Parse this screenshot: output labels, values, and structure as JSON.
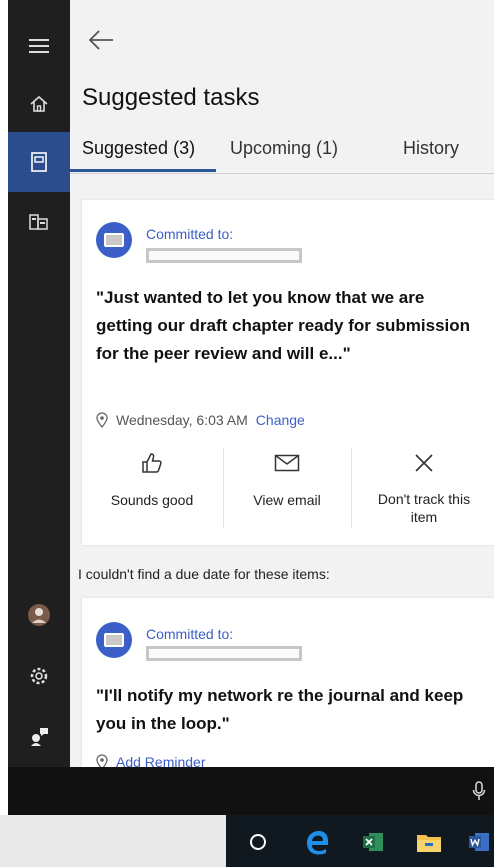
{
  "header": {
    "title": "Suggested tasks"
  },
  "tabs": [
    {
      "label": "Suggested (3)"
    },
    {
      "label": "Upcoming (1)"
    },
    {
      "label": "History"
    }
  ],
  "cards": [
    {
      "committed_label": "Committed to:",
      "quote": "\"Just wanted to let you know that we are getting our draft chapter ready for submission for the peer review and will e...\"",
      "when": "Wednesday, 6:03 AM",
      "change_label": "Change",
      "actions": [
        {
          "label": "Sounds good",
          "icon": "thumbs-up-icon"
        },
        {
          "label": "View email",
          "icon": "mail-icon"
        },
        {
          "label": "Don't track this item",
          "icon": "close-icon"
        }
      ]
    },
    {
      "committed_label": "Committed to:",
      "quote": "\"I'll notify my network re the journal and keep you in the loop.\"",
      "reminder_label": "Add Reminder"
    }
  ],
  "notice": "I couldn't find a due date for these items:",
  "colors": {
    "accent": "#3b5fc6",
    "rail": "#1f1f1f",
    "rail_active": "#2b4d8e"
  },
  "rail_icons": [
    "menu-icon",
    "home-icon",
    "notebook-icon",
    "collections-icon",
    "user-avatar",
    "settings-icon",
    "feedback-icon"
  ],
  "taskbar_icons": [
    "cortana-circle-icon",
    "edge-icon",
    "excel-icon",
    "file-explorer-icon",
    "word-icon"
  ]
}
